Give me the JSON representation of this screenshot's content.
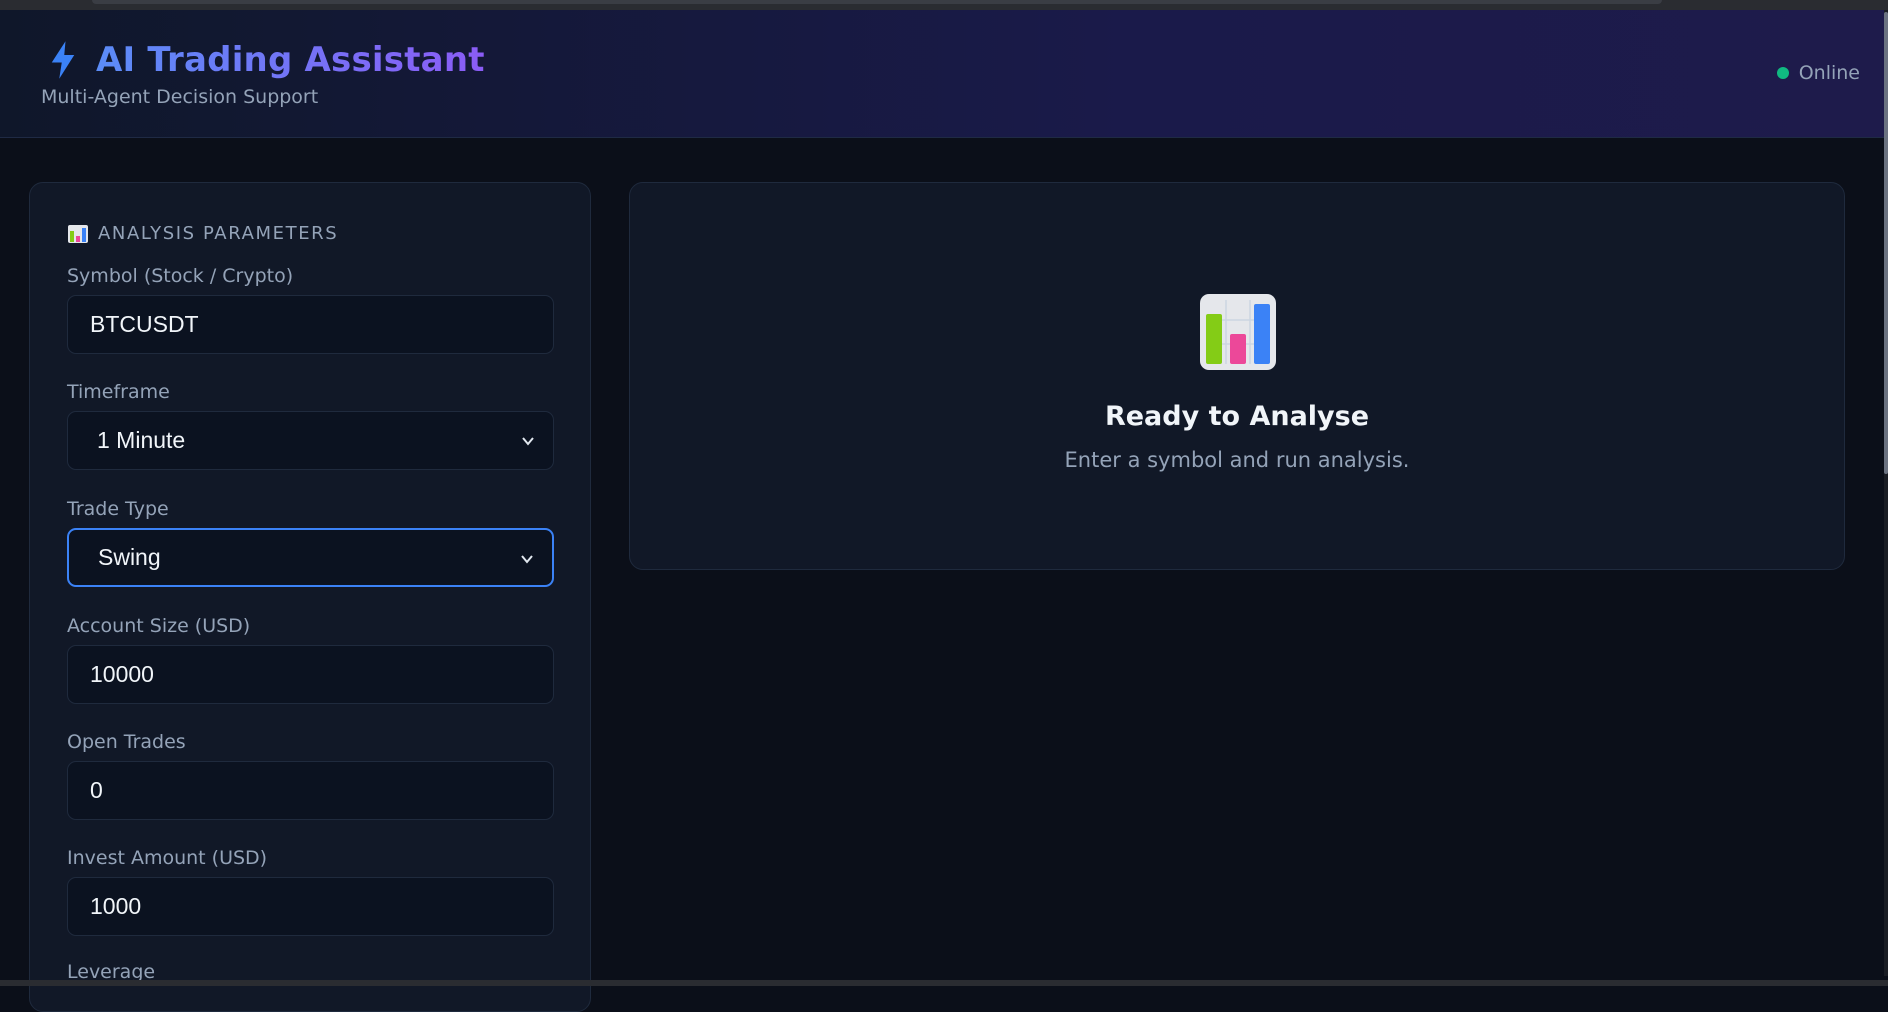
{
  "header": {
    "title": "AI Trading Assistant",
    "subtitle": "Multi-Agent Decision Support",
    "status": "Online",
    "icon": "bolt-icon"
  },
  "colors": {
    "accent_start": "#5b8cf7",
    "accent_end": "#8b5cf6",
    "status_online": "#10b981",
    "focus_border": "#3b82f6"
  },
  "params": {
    "title": "Analysis Parameters",
    "icon": "bar-chart-icon",
    "fields": {
      "symbol": {
        "label": "Symbol (Stock / Crypto)",
        "value": "BTCUSDT"
      },
      "timeframe": {
        "label": "Timeframe",
        "value": "1 Minute"
      },
      "trade_type": {
        "label": "Trade Type",
        "value": "Swing"
      },
      "account_size": {
        "label": "Account Size (USD)",
        "value": "10000"
      },
      "open_trades": {
        "label": "Open Trades",
        "value": "0"
      },
      "invest_amount": {
        "label": "Invest Amount (USD)",
        "value": "1000"
      },
      "leverage": {
        "label": "Leverage"
      }
    }
  },
  "result": {
    "icon": "bar-chart-icon",
    "title": "Ready to Analyse",
    "subtitle": "Enter a symbol and run analysis."
  }
}
